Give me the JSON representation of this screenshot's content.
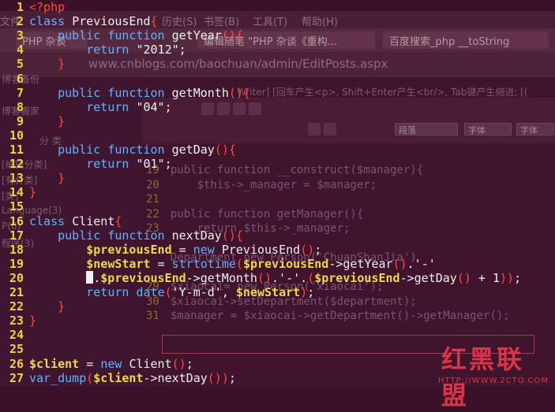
{
  "background_window": {
    "menu": [
      "文件",
      "历史(S)",
      "书签(B)",
      "工具(T)",
      "帮助(H)"
    ],
    "tabs": [
      "PHP 杂谈",
      "编辑随笔 \"PHP 杂谈《重构...",
      "百度搜索_php __toString"
    ],
    "url": "www.cnblogs.com/baochuan/admin/EditPosts.aspx",
    "editor_hint": "Writer] [回车产生<p>, Shift+Enter产生<br/>, Tab键产生缩进; [(",
    "format_label": "段落",
    "font_label": "字体",
    "left_panel": [
      "博客备份",
      "博客搬家",
      "分  类",
      "[编辑分类]",
      "[有分类]",
      "[类]",
      "Language(3)",
      "P(6)",
      "程序(3)"
    ],
    "bg_code": [
      {
        "n": "19",
        "t": "public function __construct($manager){"
      },
      {
        "n": "20",
        "t": "    $this->_manager = $manager;"
      },
      {
        "n": "21",
        "t": ""
      },
      {
        "n": "22",
        "t": "public function getManager(){"
      },
      {
        "n": "23",
        "t": "    return $this->_manager;"
      },
      {
        "n": "",
        "t": ""
      },
      {
        "n": "",
        "t": "Department new Person('ChuanShanJia')"
      },
      {
        "n": "",
        "t": ""
      },
      {
        "n": "29",
        "t": "$xiaocai= new Person('xiaocai');"
      },
      {
        "n": "30",
        "t": "$xiaocai->setDepartment($department);"
      },
      {
        "n": "31",
        "t": "$manager = $xiaocai->getDepartment()->getManager();"
      }
    ]
  },
  "code": [
    {
      "n": "1",
      "html": "<span class='tag'>&lt;?php</span>"
    },
    {
      "n": "2",
      "html": "<span class='kw'>class</span> <span class='fn'>PreviousEnd</span><span class='br'>{</span>"
    },
    {
      "n": "3",
      "html": "    <span class='kw'>public function</span> <span class='fn'>getYear</span><span class='br'>(){</span>"
    },
    {
      "n": "4",
      "html": "        <span class='kw'>return</span> <span class='st'>\"2012\"</span><span class='pl'>;</span>"
    },
    {
      "n": "5",
      "html": "    <span class='br'>}</span>"
    },
    {
      "n": "6",
      "html": ""
    },
    {
      "n": "7",
      "html": "    <span class='kw'>public function</span> <span class='fn'>getMonth</span><span class='br'>(){</span>"
    },
    {
      "n": "8",
      "html": "        <span class='kw'>return</span> <span class='st'>\"04\"</span><span class='pl'>;</span>"
    },
    {
      "n": "9",
      "html": "    <span class='br'>}</span>"
    },
    {
      "n": "10",
      "html": ""
    },
    {
      "n": "11",
      "html": "    <span class='kw'>public function</span> <span class='fn'>getDay</span><span class='br'>(){</span>"
    },
    {
      "n": "12",
      "html": "        <span class='kw'>return</span> <span class='st'>\"01\"</span><span class='pl'>;</span>"
    },
    {
      "n": "13",
      "html": "    <span class='br'>}</span>"
    },
    {
      "n": "14",
      "html": "<span class='br'>}</span>"
    },
    {
      "n": "15",
      "html": ""
    },
    {
      "n": "16",
      "html": "<span class='kw'>class</span> <span class='fn'>Client</span><span class='br'>{</span>"
    },
    {
      "n": "17",
      "html": "    <span class='kw'>public function</span> <span class='fn'>nextDay</span><span class='br'>(){</span>"
    },
    {
      "n": "18",
      "html": "        <span class='vr'>$previousEnd</span> <span class='pl'>=</span> <span class='kw'>new</span> <span class='fn'>PreviousEnd</span><span class='br'>()</span><span class='pl'>;</span>"
    },
    {
      "n": "19",
      "html": "        <span class='vr'>$newStart</span> <span class='pl'>=</span> <span class='kw'>strtotime</span><span class='br'>(</span><span class='vr'>$previousEnd</span><span class='pl'>-&gt;getYear</span><span class='br'>()</span><span class='pl'>.'-'</span>"
    },
    {
      "n": "20",
      "html": "        <span class='cursor'></span><span class='pl'>.</span><span class='vr'>$previousEnd</span><span class='pl'>-&gt;getMonth</span><span class='br'>()</span><span class='pl'>.'-'.</span><span class='br'>(</span><span class='vr'>$previousEnd</span><span class='pl'>-&gt;getDay</span><span class='br'>()</span><span class='pl'> + 1</span><span class='br'>))</span><span class='pl'>;</span>"
    },
    {
      "n": "21",
      "html": "        <span class='kw'>return</span> <span class='kw'>date</span><span class='br'>(</span><span class='st'>'Y-m-d'</span><span class='pl'>, </span><span class='vr'>$newStart</span><span class='br'>)</span><span class='pl'>;</span>"
    },
    {
      "n": "22",
      "html": "    <span class='br'>}</span>"
    },
    {
      "n": "23",
      "html": "<span class='br'>}</span>"
    },
    {
      "n": "24",
      "html": ""
    },
    {
      "n": "25",
      "html": ""
    },
    {
      "n": "26",
      "html": "<span class='vr'>$client</span> <span class='pl'>=</span> <span class='kw'>new</span> <span class='fn'>Client</span><span class='br'>()</span><span class='pl'>;</span>"
    },
    {
      "n": "27",
      "html": "<span class='kw'>var_dump</span><span class='br'>(</span><span class='vr'>$client</span><span class='pl'>-&gt;nextDay</span><span class='br'>()</span><span class='br'>)</span><span class='pl'>;</span>"
    }
  ],
  "watermark": {
    "big": "红黑联盟",
    "small": "HTTP://WWW.2CTO.COM"
  }
}
